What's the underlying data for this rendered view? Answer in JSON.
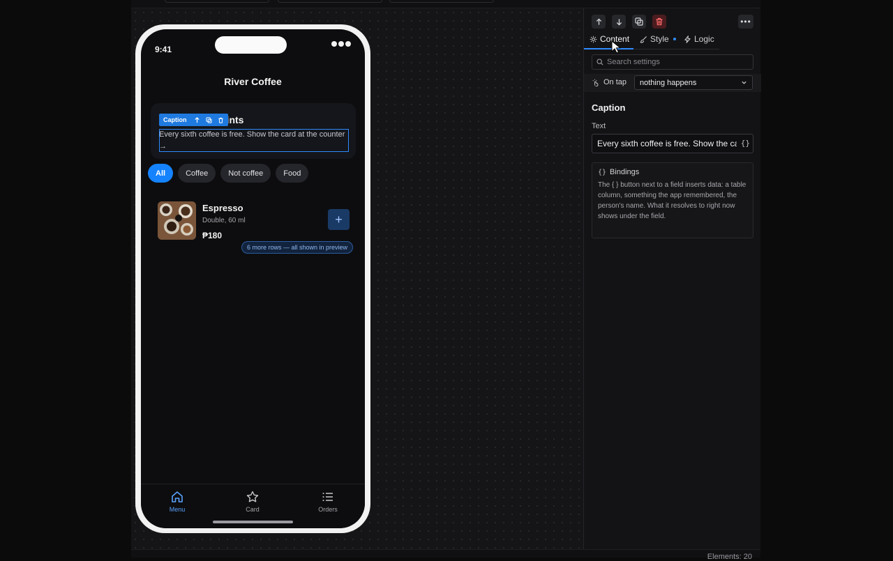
{
  "status_bar": {
    "time": "9:41"
  },
  "app": {
    "title": "River Coffee"
  },
  "loyalty": {
    "title_visible": "oints",
    "caption": "Every sixth coffee is free. Show the card at the counter →"
  },
  "selection_toolbar": {
    "label": "Caption",
    "icons": [
      "arrow-up-icon",
      "duplicate-icon",
      "trash-icon"
    ]
  },
  "filters": [
    {
      "label": "All",
      "active": true
    },
    {
      "label": "Coffee",
      "active": false
    },
    {
      "label": "Not coffee",
      "active": false
    },
    {
      "label": "Food",
      "active": false
    }
  ],
  "product": {
    "name": "Espresso",
    "description": "Double, 60 ml",
    "price": "₱180",
    "add_label": "+"
  },
  "more_rows": "6 more rows — all shown in preview",
  "tabbar": [
    {
      "label": "Menu",
      "icon": "home-icon",
      "active": true
    },
    {
      "label": "Card",
      "icon": "star-icon",
      "active": false
    },
    {
      "label": "Orders",
      "icon": "list-icon",
      "active": false
    }
  ],
  "inspector": {
    "tabs": [
      {
        "label": "Content",
        "icon": "gear-icon",
        "active": true
      },
      {
        "label": "Style",
        "icon": "brush-icon",
        "active": false
      },
      {
        "label": "Logic",
        "icon": "bolt-icon",
        "active": false
      }
    ],
    "search_placeholder": "Search settings",
    "on_tap_label": "On tap",
    "on_tap_value": "nothing happens",
    "section_title": "Caption",
    "text_label": "Text",
    "text_value": "Every sixth coffee is free. Show the card at the counter →",
    "braces": "{}",
    "bindings_title": "Bindings",
    "bindings_icon": "{}",
    "bindings_body": "The { } button next to a field inserts data: a table column, something the app remembered, the person's name. What it resolves to right now shows under the field."
  },
  "footer": {
    "elements": "Elements: 20"
  },
  "colors": {
    "accent": "#1583ff",
    "danger": "#ff6b6b",
    "canvas": "#151517"
  }
}
